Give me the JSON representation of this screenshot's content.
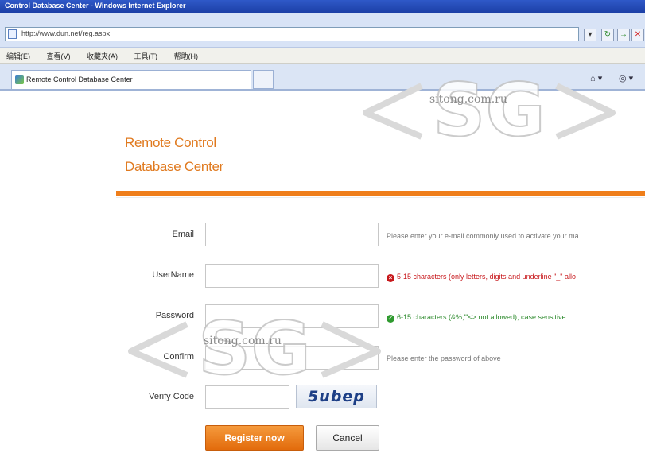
{
  "window": {
    "title": "Control Database Center - Windows Internet Explorer",
    "address": "http://www.dun.net/reg.aspx"
  },
  "menu": [
    "编辑(E)",
    "查看(V)",
    "收藏夹(A)",
    "工具(T)",
    "帮助(H)"
  ],
  "tab": {
    "label": "Remote Control Database Center"
  },
  "watermark": {
    "text": "sitong.com.ru",
    "logo": "SG"
  },
  "logo": {
    "line1": "Remote Control",
    "line2": "Database Center"
  },
  "form": {
    "email": {
      "label": "Email",
      "value": "",
      "hint": "Please enter your e-mail commonly used to activate your ma"
    },
    "username": {
      "label": "UserName",
      "value": "",
      "hint": "5-15 characters (only letters, digits and underline \"_\" allo",
      "status": "error"
    },
    "password": {
      "label": "Password",
      "value": "",
      "hint": "6-15 characters (&%;'\"<> not allowed), case sensitive",
      "status": "ok"
    },
    "confirm": {
      "label": "Confirm",
      "value": "",
      "hint": "Please enter the password of above"
    },
    "verify": {
      "label": "Verify Code",
      "value": "",
      "captcha": "5ubep"
    },
    "register_label": "Register now",
    "cancel_label": "Cancel"
  },
  "colors": {
    "accent": "#ef7e1a",
    "error": "#c7171b",
    "ok": "#2c8a2c",
    "titlebar": "#1c3fa6"
  }
}
